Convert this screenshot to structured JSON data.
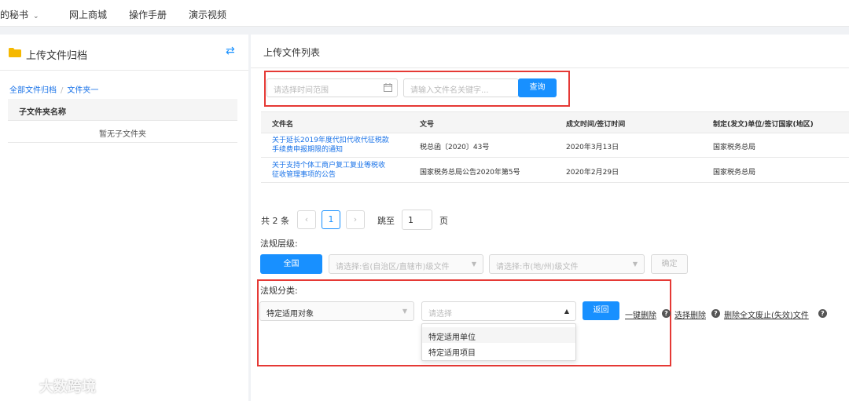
{
  "topnav": {
    "items": [
      "的秘书",
      "网上商城",
      "操作手册",
      "演示视频"
    ]
  },
  "left_panel": {
    "title": "上传文件归档",
    "breadcrumb": [
      "全部文件归档",
      "/",
      "文件夹一"
    ],
    "column_header": "子文件夹名称",
    "empty_text": "暂无子文件夹"
  },
  "main": {
    "title": "上传文件列表",
    "search": {
      "date_placeholder": "请选择时间范围",
      "keyword_placeholder": "请输入文件名关键字...",
      "query_label": "查询"
    },
    "table": {
      "headers": [
        "文件名",
        "文号",
        "成文时间/签订时间",
        "制定(发文)单位/签订国家(地区)"
      ],
      "rows": [
        {
          "name_line1": "关于延长2019年度代扣代收代征税款",
          "name_line2": "手续费申报期限的通知",
          "doc_no": "税总函〔2020〕43号",
          "date": "2020年3月13日",
          "issuer": "国家税务总局"
        },
        {
          "name_line1": "关于支持个体工商户复工复业等税收",
          "name_line2": "征收管理事项的公告",
          "doc_no": "国家税务总局公告2020年第5号",
          "date": "2020年2月29日",
          "issuer": "国家税务总局"
        }
      ]
    },
    "pagination": {
      "total": "共 2 条",
      "prev": "‹",
      "current": "1",
      "next": "›",
      "jump_label": "跳至",
      "jump_value": "1",
      "page_suffix": "页"
    },
    "level": {
      "label": "法规层级:",
      "all_button": "全国",
      "province_placeholder": "请选择:省(自治区/直辖市)级文件",
      "city_placeholder": "请选择:市(地/州)级文件",
      "confirm_label": "确定"
    },
    "category": {
      "label": "法规分类:",
      "first_select": "特定适用对象",
      "second_placeholder": "请选择",
      "dropdown_options": [
        "特定适用单位",
        "特定适用项目"
      ],
      "back_button": "返回",
      "actions": [
        "一键删除",
        "选择删除",
        "删除全文废止(失效)文件"
      ]
    }
  },
  "watermark": {
    "text": "大数跨境"
  },
  "colors": {
    "accent": "#1890ff",
    "highlight_box": "#e53935",
    "link": "#1a73e8",
    "folder": "#f5b800"
  }
}
